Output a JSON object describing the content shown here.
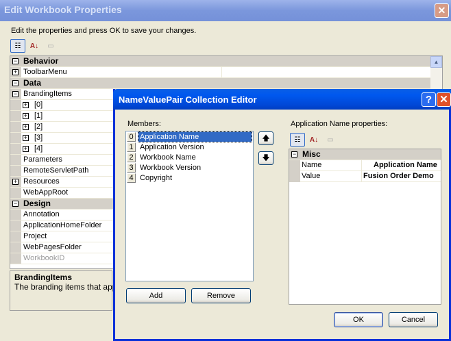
{
  "outer": {
    "title": "Edit Workbook Properties",
    "close": "✕",
    "instructions": "Edit the properties and press OK to save your changes.",
    "grid": [
      {
        "type": "cat",
        "label": "Behavior",
        "sign": "−"
      },
      {
        "type": "item",
        "label": "ToolbarMenu",
        "sign": "+"
      },
      {
        "type": "cat",
        "label": "Data",
        "sign": "−"
      },
      {
        "type": "item",
        "label": "BrandingItems",
        "sign": "−",
        "gutter": true
      },
      {
        "type": "sub",
        "label": "[0]",
        "sign": "+"
      },
      {
        "type": "sub",
        "label": "[1]",
        "sign": "+"
      },
      {
        "type": "sub",
        "label": "[2]",
        "sign": "+"
      },
      {
        "type": "sub",
        "label": "[3]",
        "sign": "+"
      },
      {
        "type": "sub",
        "label": "[4]",
        "sign": "+"
      },
      {
        "type": "item",
        "label": "Parameters"
      },
      {
        "type": "item",
        "label": "RemoteServletPath"
      },
      {
        "type": "item",
        "label": "Resources",
        "sign": "+"
      },
      {
        "type": "item",
        "label": "WebAppRoot"
      },
      {
        "type": "cat",
        "label": "Design",
        "sign": "−"
      },
      {
        "type": "item",
        "label": "Annotation"
      },
      {
        "type": "item",
        "label": "ApplicationHomeFolder"
      },
      {
        "type": "item",
        "label": "Project"
      },
      {
        "type": "item",
        "label": "WebPagesFolder"
      },
      {
        "type": "item",
        "label": "WorkbookID",
        "disabled": true
      }
    ],
    "description": {
      "title": "BrandingItems",
      "text": "The branding items that appear"
    }
  },
  "editor": {
    "title": "NameValuePair Collection Editor",
    "help": "?",
    "close": "✕",
    "members_label": "Members:",
    "members": [
      {
        "index": "0",
        "name": "Application Name"
      },
      {
        "index": "1",
        "name": "Application Version"
      },
      {
        "index": "2",
        "name": "Workbook Name"
      },
      {
        "index": "3",
        "name": "Workbook Version"
      },
      {
        "index": "4",
        "name": "Copyright"
      }
    ],
    "properties_label": "Application Name properties:",
    "category": "Misc",
    "props": [
      {
        "name": "Name",
        "value": "Application Name"
      },
      {
        "name": "Value",
        "value": "Fusion Order Demo"
      }
    ],
    "add": "Add",
    "remove": "Remove",
    "ok": "OK",
    "cancel": "Cancel"
  }
}
